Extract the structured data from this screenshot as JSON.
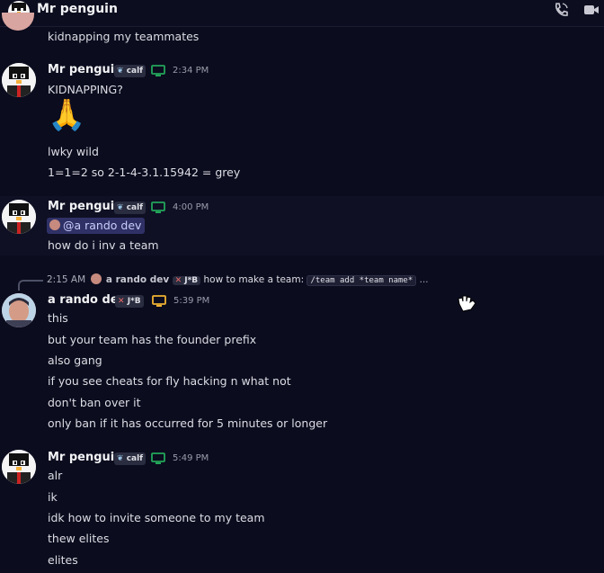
{
  "header": {
    "title": "Mr penguin"
  },
  "partial_top": {
    "text": "kidnapping my teammates"
  },
  "messages": [
    {
      "author": "Mr penguin",
      "tag": "calf",
      "time": "2:34 PM",
      "lines": [
        "KIDNAPPING?",
        "🙏",
        "lwky wild",
        "1=1=2 so 2-1-4-3.1.15942 = grey"
      ]
    },
    {
      "author": "Mr penguin",
      "tag": "calf",
      "time": "4:00 PM",
      "mention": "@a rando dev",
      "lines": [
        "how do i inv a team"
      ]
    },
    {
      "reply": {
        "time": "2:15 AM",
        "author": "a rando dev",
        "tag": "J*B",
        "text": "how to make a team:",
        "code": "/team add *team name*",
        "ellipsis": "..."
      },
      "author": "a rando dev",
      "tag": "J*B",
      "time": "5:39 PM",
      "lines": [
        "this",
        "but your team has the founder prefix",
        "also gang",
        "if you see cheats for fly hacking n what not",
        "don't ban over it",
        "only ban if it has occurred for 5 minutes or longer"
      ]
    },
    {
      "author": "Mr penguin",
      "tag": "calf",
      "time": "5:49 PM",
      "lines": [
        "alr",
        "ik",
        "idk how to invite someone to my team",
        "thew elites",
        "elites"
      ]
    }
  ],
  "colors": {
    "background": "#0b0c1e",
    "online": "#23a55a",
    "device_green": "#23a55a",
    "device_orange": "#f0b232",
    "mention_bg": "#2f3166"
  },
  "icons": [
    "phone-icon",
    "video-icon",
    "leaf-icon",
    "sword-icon",
    "monitor-icon"
  ]
}
